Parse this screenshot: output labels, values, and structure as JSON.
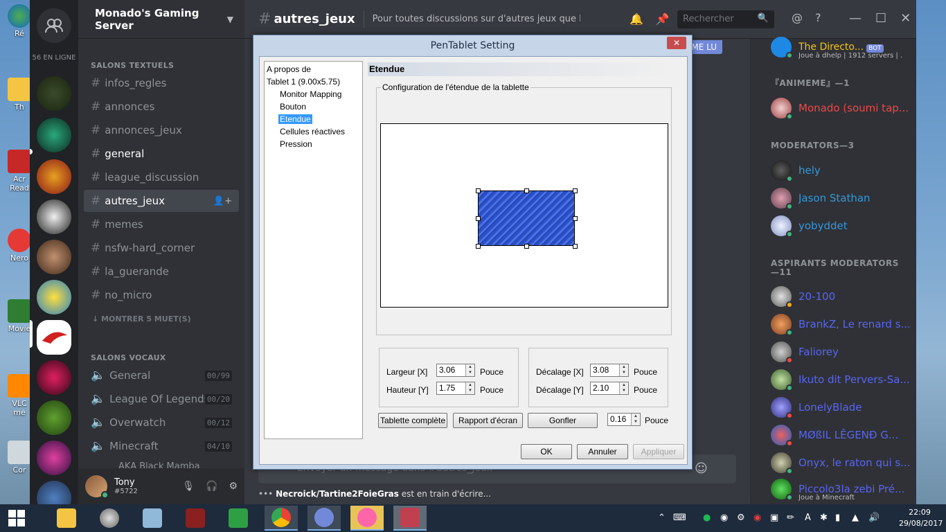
{
  "desktop": {
    "icons": [
      "Ré",
      "Th",
      "Acr Read",
      "Nero",
      "Movie",
      "VLC me",
      "Cor"
    ]
  },
  "discord": {
    "server_name": "Monado's Gaming Server",
    "online_count": "56 EN LIGNE",
    "text_category": "SALONS TEXTUELS",
    "text_channels": [
      "infos_regles",
      "annonces",
      "annonces_jeux",
      "general",
      "league_discussion",
      "autres_jeux",
      "memes",
      "nsfw-hard_corner",
      "la_guerande",
      "no_micro"
    ],
    "show_muted": "MONTRER 5 MUET(S)",
    "voice_category": "SALONS VOCAUX",
    "voice_channels": [
      {
        "name": "General",
        "count": "00/99"
      },
      {
        "name": "League Of Legends",
        "count": "00/20"
      },
      {
        "name": "Overwatch",
        "count": "00/12"
      },
      {
        "name": "Minecraft",
        "count": "04/10"
      }
    ],
    "voice_user": "AKA Black Mamba",
    "user": {
      "name": "Tony",
      "tag": "#5722"
    },
    "chat": {
      "channel": "autres_jeux",
      "topic": "Pour toutes discussions sur d'autres jeux que Le...",
      "search_placeholder": "Rechercher",
      "new_messages": "OMME LU",
      "input_placeholder": "Envoyer un message dans #autres_jeux",
      "typing_user": "Necroick/Tartine2FoieGras",
      "typing_text": "est en train d'écrire..."
    },
    "members": {
      "top_member": {
        "name": "The Directo...",
        "badge": "BOT",
        "activity": "Joue à dhelp | 1912 servers | ..."
      },
      "cat1": "『ANIMEME』—1",
      "cat1_members": [
        {
          "name": "Monado (soumi tap...",
          "color": "#f04747"
        }
      ],
      "cat2": "MODERATORS—3",
      "cat2_members": [
        {
          "name": "hely",
          "color": "#3498db"
        },
        {
          "name": "Jason Stathan",
          "color": "#3498db"
        },
        {
          "name": "yobyddet",
          "color": "#3498db"
        }
      ],
      "cat3": "ASPIRANTS MODERATORS —11",
      "cat3_members": [
        {
          "name": "20-100",
          "color": "#5865f2"
        },
        {
          "name": "BrankZ, Le renard s...",
          "color": "#5865f2"
        },
        {
          "name": "Faliorey",
          "color": "#5865f2"
        },
        {
          "name": "Ikuto dit Pervers-Sa...",
          "color": "#5865f2"
        },
        {
          "name": "LonelyBlade",
          "color": "#5865f2"
        },
        {
          "name": "MØßIL LÊGENÐ G...",
          "color": "#5865f2"
        },
        {
          "name": "Onyx, le raton qui s...",
          "color": "#5865f2"
        },
        {
          "name": "Piccolo3la zebi Pré...",
          "color": "#5865f2",
          "activity": "Joue à Minecraft"
        }
      ]
    }
  },
  "dialog": {
    "title": "PenTablet Setting",
    "tree": {
      "about": "A propos de",
      "tablet": "Tablet  1 (9.00x5.75)",
      "items": [
        "Monitor Mapping",
        "Bouton",
        "Etendue",
        "Cellules réactives",
        "Pression"
      ]
    },
    "panel_title": "Etendue",
    "group_label": "Configuration de l'étendue de la tablette",
    "width_label": "Largeur [X]",
    "width_value": "3.06",
    "height_label": "Hauteur [Y]",
    "height_value": "1.75",
    "offset_x_label": "Décalage [X]",
    "offset_x_value": "3.08",
    "offset_y_label": "Décalage [Y]",
    "offset_y_value": "2.10",
    "unit": "Pouce",
    "btn_full": "Tablette complète",
    "btn_ratio": "Rapport d'écran",
    "btn_inflate": "Gonfler",
    "inflate_value": "0.16",
    "ok": "OK",
    "cancel": "Annuler",
    "apply": "Appliquer"
  },
  "taskbar": {
    "time": "22:09",
    "date": "29/08/2017",
    "ime": "A"
  }
}
